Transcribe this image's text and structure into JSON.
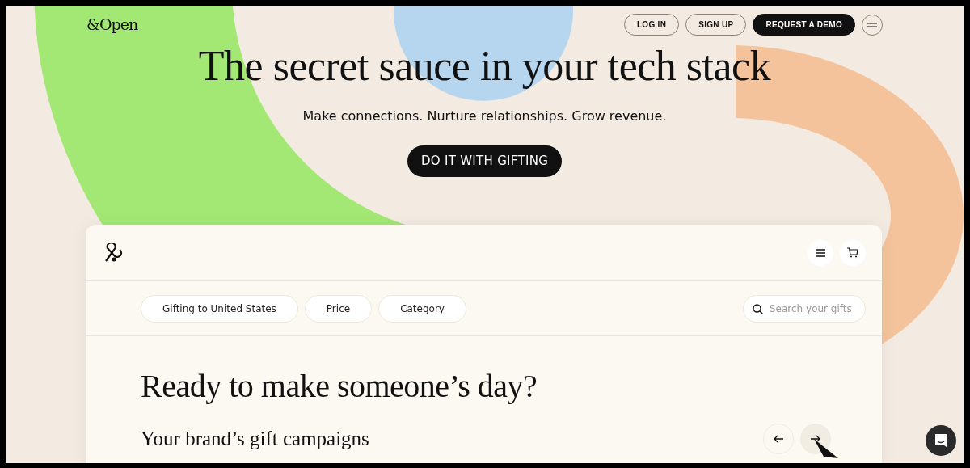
{
  "nav": {
    "logo": "&Open",
    "buttons": [
      {
        "label": "LOG IN",
        "kind": "outline"
      },
      {
        "label": "SIGN UP",
        "kind": "outline"
      },
      {
        "label": "REQUEST A DEMO",
        "kind": "solid"
      }
    ]
  },
  "hero": {
    "title": "The secret sauce in your tech stack",
    "subtitle": "Make connections. Nurture relationships. Grow revenue.",
    "cta": "DO IT WITH GIFTING"
  },
  "store": {
    "filters": [
      "Gifting to United States",
      "Price",
      "Category"
    ],
    "search": {
      "placeholder": "Search your gifts"
    },
    "heading": "Ready to make someone’s day?",
    "subheading": "Your brand’s gift campaigns"
  }
}
